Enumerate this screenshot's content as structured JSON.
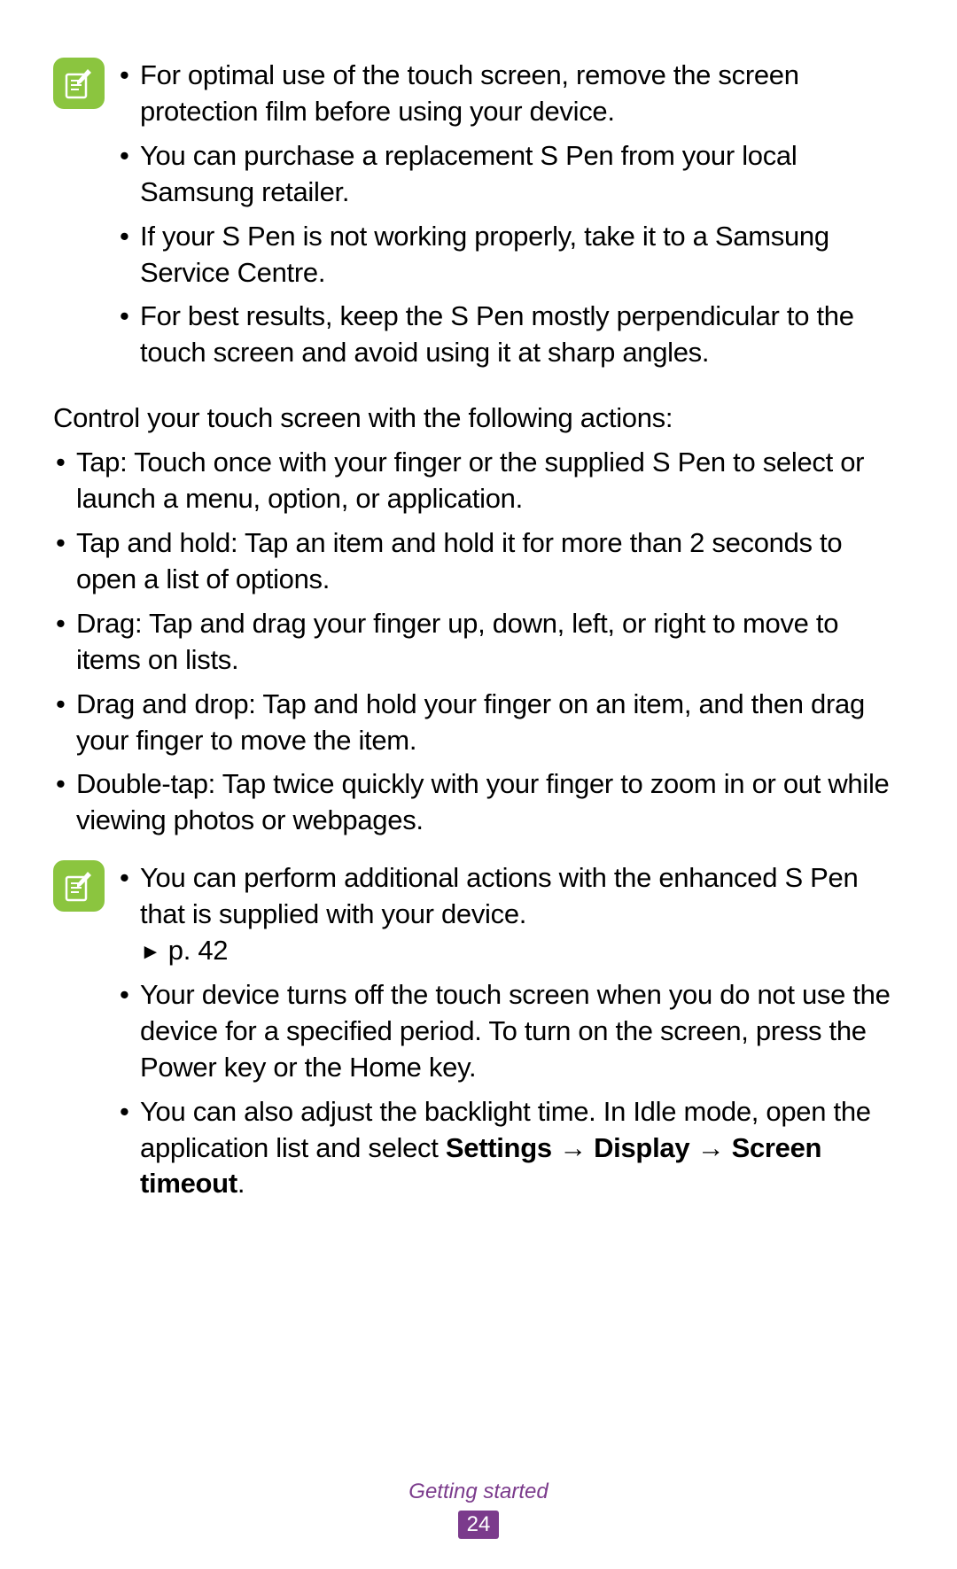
{
  "note1": {
    "items": [
      "For optimal use of the touch screen, remove the screen protection film before using your device.",
      "You can purchase a replacement S Pen from your local Samsung retailer.",
      "If your S Pen is not working properly, take it to a Samsung Service Centre.",
      "For best results, keep the S Pen mostly perpendicular to the touch screen and avoid using it at sharp angles."
    ]
  },
  "intro": "Control your touch screen with the following actions:",
  "mainList": [
    "Tap: Touch once with your finger or the supplied S Pen to select or launch a menu, option, or application.",
    "Tap and hold: Tap an item and hold it for more than 2 seconds to open a list of options.",
    "Drag: Tap and drag your finger up, down, left, or right to move to items on lists.",
    "Drag and drop: Tap and hold your finger on an item, and then drag your finger to move the item.",
    "Double-tap: Tap twice quickly with your finger to zoom in or out while viewing photos or webpages."
  ],
  "note2": {
    "item1_pre": "You can perform additional actions with the enhanced S Pen that is supplied with your device. ",
    "item1_pageref": "p. 42",
    "item2": "Your device turns off the touch screen when you do not use the device for a specified period. To turn on the screen, press the Power key or the Home key.",
    "item3_pre": "You can also adjust the backlight time. In Idle mode, open the application list and select ",
    "item3_bold_a": "Settings",
    "item3_arrow1": " → ",
    "item3_bold_b": "Display",
    "item3_arrow2": " → ",
    "item3_bold_c": "Screen timeout",
    "item3_end": "."
  },
  "footer": {
    "section": "Getting started",
    "page": "24"
  }
}
